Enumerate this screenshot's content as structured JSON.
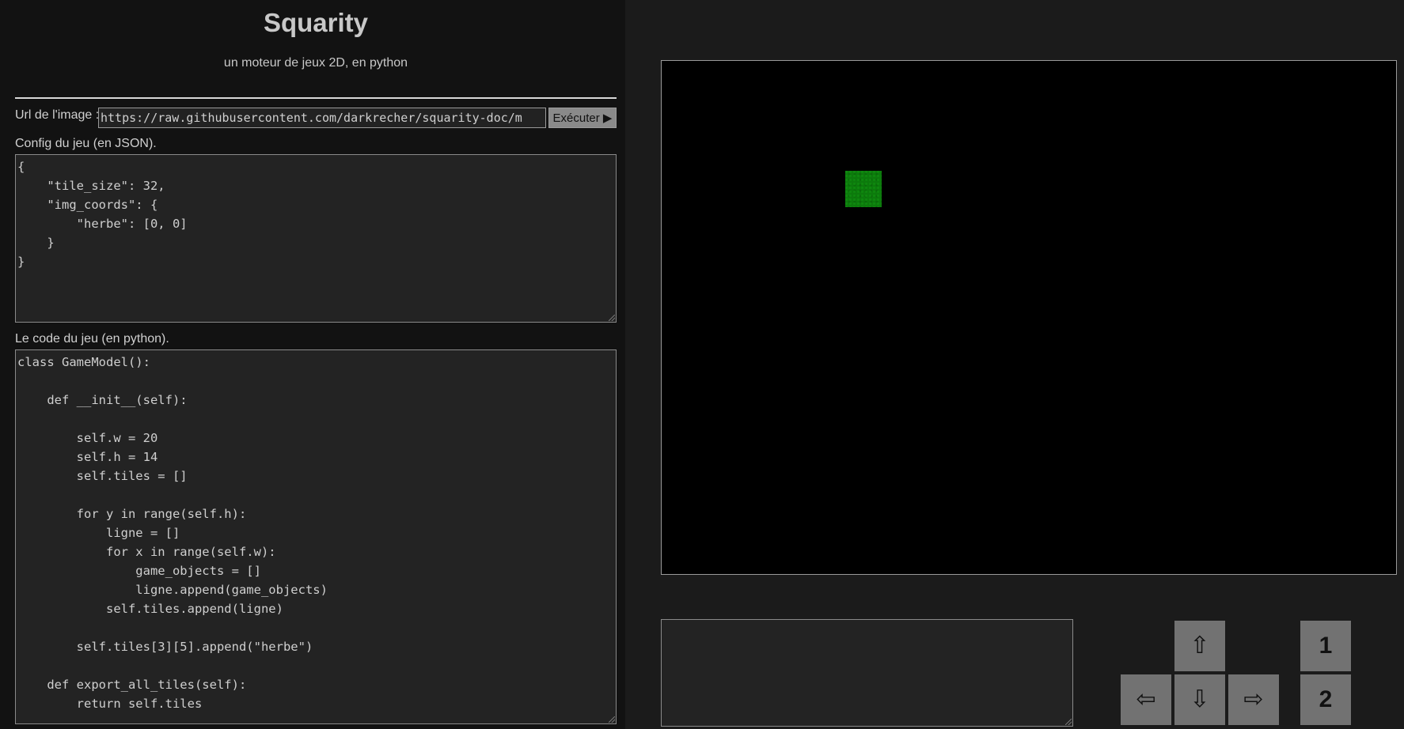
{
  "header": {
    "title": "Squarity",
    "subtitle": "un moteur de jeux 2D, en python"
  },
  "image_url": {
    "label": "Url de l'image :",
    "value": "https://raw.githubusercontent.com/darkrecher/squarity-doc/m"
  },
  "execute_button": {
    "label": "Exécuter ▶"
  },
  "config": {
    "label": "Config du jeu (en JSON).",
    "lines": [
      "{",
      "    \"tile_size\": 32,",
      "    \"img_coords\": {",
      "        \"herbe\": [0, 0]",
      "    }",
      "}"
    ]
  },
  "code": {
    "label": "Le code du jeu (en python).",
    "lines": [
      "class GameModel():",
      "",
      "    def __init__(self):",
      "",
      "        self.w = 20",
      "        self.h = 14",
      "        self.tiles = []",
      "",
      "        for y in range(self.h):",
      "            ligne = []",
      "            for x in range(self.w):",
      "                game_objects = []",
      "                ligne.append(game_objects)",
      "            self.tiles.append(ligne)",
      "",
      "        self.tiles[3][5].append(\"herbe\")",
      "",
      "    def export_all_tiles(self):",
      "        return self.tiles"
    ]
  },
  "controls": {
    "up": "⇧",
    "left": "⇦",
    "down": "⇩",
    "right": "⇨",
    "action_1": "1",
    "action_2": "2"
  },
  "colors": {
    "tile_herbe": "#0c7a0c",
    "canvas_bg": "#000000",
    "button_bg": "#727272"
  }
}
